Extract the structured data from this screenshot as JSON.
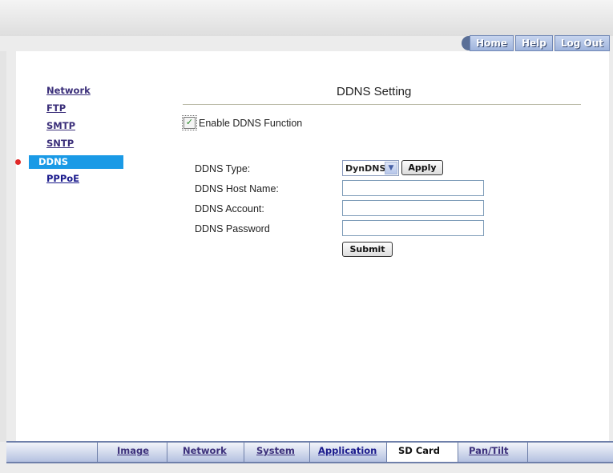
{
  "topnav": {
    "home": "Home",
    "help": "Help",
    "logout": "Log Out"
  },
  "sidebar": {
    "items": [
      {
        "label": "Network"
      },
      {
        "label": "FTP"
      },
      {
        "label": "SMTP"
      },
      {
        "label": "SNTP"
      },
      {
        "label": "DDNS"
      },
      {
        "label": "PPPoE"
      }
    ]
  },
  "main": {
    "title": "DDNS Setting",
    "enable_label": "Enable DDNS Function",
    "enable_checked": true,
    "type_label": "DDNS Type:",
    "type_value": "DynDNS",
    "apply_label": "Apply",
    "host_label": "DDNS Host Name:",
    "host_value": "",
    "account_label": "DDNS Account:",
    "account_value": "",
    "password_label": "DDNS Password",
    "password_value": "",
    "submit_label": "Submit"
  },
  "bottomnav": {
    "tabs": [
      {
        "label": "Image"
      },
      {
        "label": "Network"
      },
      {
        "label": "System"
      },
      {
        "label": "Application"
      },
      {
        "label": "SD Card"
      },
      {
        "label": "Pan/Tilt"
      }
    ]
  },
  "colors": {
    "accent": "#1a9ae6",
    "link": "#3b2f7a",
    "nav_border": "#6f80aa"
  }
}
